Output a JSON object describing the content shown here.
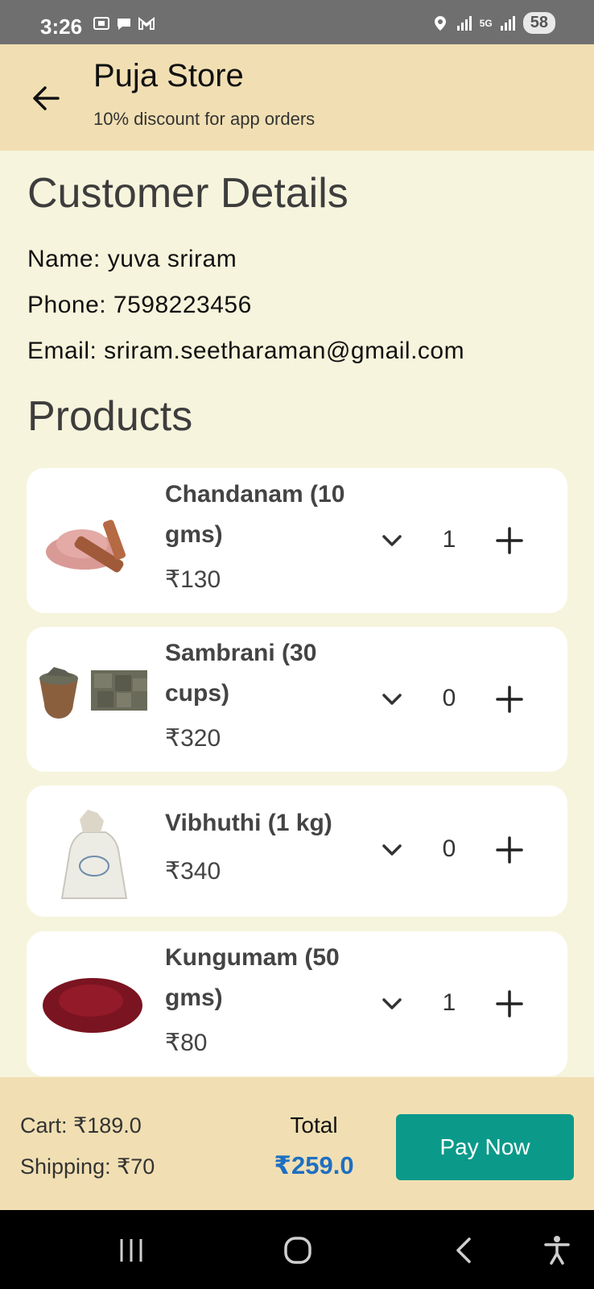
{
  "status": {
    "time": "3:26",
    "network": "5G",
    "battery": "58"
  },
  "header": {
    "title": "Puja Store",
    "subtitle": "10% discount for app orders"
  },
  "customer": {
    "title": "Customer Details",
    "name": "Name: yuva sriram",
    "phone": "Phone: 7598223456",
    "email": "Email: sriram.seetharaman@gmail.com"
  },
  "products_title": "Products",
  "products": [
    {
      "name": "Chandanam (10 gms)",
      "price": "₹130",
      "qty": "1"
    },
    {
      "name": "Sambrani (30 cups)",
      "price": "₹320",
      "qty": "0"
    },
    {
      "name": "Vibhuthi (1 kg)",
      "price": "₹340",
      "qty": "0"
    },
    {
      "name": "Kungumam (50 gms)",
      "price": "₹80",
      "qty": "1"
    }
  ],
  "summary": {
    "cart": "Cart: ₹189.0",
    "shipping": "Shipping: ₹70",
    "total_label": "Total",
    "total_value": "₹259.0",
    "pay_label": "Pay Now"
  },
  "colors": {
    "header_bg": "#f1dfb3",
    "page_bg": "#f6f4dc",
    "pay_button": "#0b9a8a",
    "total_value": "#1e6fc2"
  }
}
